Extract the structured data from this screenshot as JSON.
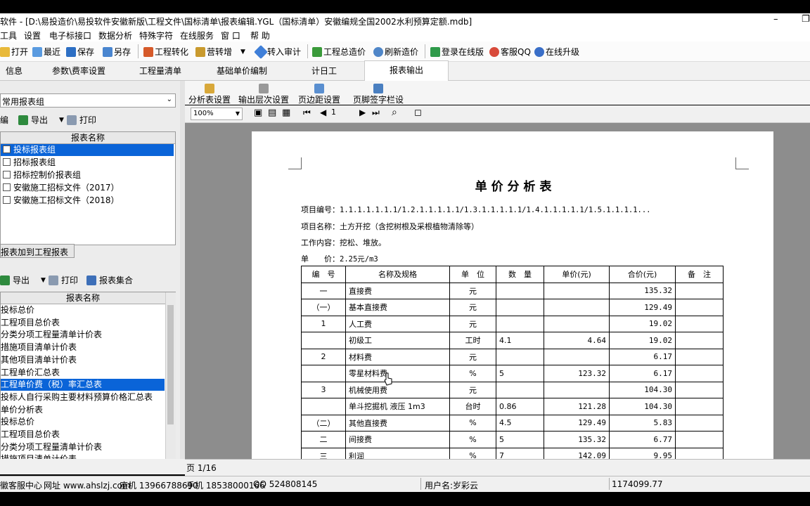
{
  "window": {
    "title": "软件 - [D:\\易投造价\\易投软件安徽新版\\工程文件\\国标清单\\报表编辑.YGL（国标清单）安徽编规全国2002水利预算定额.mdb]",
    "minimize": "–",
    "restore": "❐"
  },
  "menu": [
    "工具",
    "设置",
    "电子标接口",
    "数据分析",
    "特殊字符",
    "在线服务",
    "窗 口",
    "帮 助"
  ],
  "toolbar": {
    "open": "打开",
    "recent": "最近",
    "save": "保存",
    "save_as": "另存",
    "convert": "工程转化",
    "camp": "营转增",
    "import_audit": "转入审计",
    "total_price": "工程总造价",
    "refresh_price": "刷新造价",
    "login_online": "登录在线版",
    "service_qq": "客服QQ",
    "upgrade": "在线升级"
  },
  "tabs": [
    "信息",
    "参数\\费率设置",
    "工程量清单",
    "基础单价编制",
    "计日工",
    "报表输出"
  ],
  "left": {
    "group_select": "常用报表组",
    "top_actions": {
      "edit": "编",
      "export": "导出",
      "print": "打印"
    },
    "top_header": "报表名称",
    "groups": [
      {
        "label": "投标报表组",
        "selected": true
      },
      {
        "label": "招标报表组",
        "selected": false
      },
      {
        "label": "招标控制价报表组",
        "selected": false
      },
      {
        "label": "安徽施工招标文件（2017）",
        "selected": false
      },
      {
        "label": "安徽施工招标文件（2018）",
        "selected": false
      }
    ],
    "add_to_project": "报表加到工程报表",
    "bottom_actions": {
      "export": "导出",
      "print": "打印",
      "collection": "报表集合"
    },
    "bottom_header": "报表名称",
    "reports": [
      {
        "label": "投标总价",
        "selected": false
      },
      {
        "label": "工程项目总价表",
        "selected": false
      },
      {
        "label": "分类分项工程量清单计价表",
        "selected": false
      },
      {
        "label": "措施项目清单计价表",
        "selected": false
      },
      {
        "label": "其他项目清单计价表",
        "selected": false
      },
      {
        "label": "工程单价汇总表",
        "selected": false
      },
      {
        "label": "工程单价费（税）率汇总表",
        "selected": true
      },
      {
        "label": "投标人自行采购主要材料预算价格汇总表",
        "selected": false
      },
      {
        "label": "单价分析表",
        "selected": false
      },
      {
        "label": "投标总价",
        "selected": false
      },
      {
        "label": "工程项目总价表",
        "selected": false
      },
      {
        "label": "分类分项工程量清单计价表",
        "selected": false
      },
      {
        "label": "措施项目清单计价表",
        "selected": false
      }
    ]
  },
  "report_tools": {
    "analysis_settings": "分析表设置",
    "output_level": "输出层次设置",
    "margin_settings": "页边距设置",
    "header_footer": "页脚签字栏设置",
    "zoom": "100%",
    "page_input": "1"
  },
  "report": {
    "title": "单 价 分 析 表",
    "code_label": "项目编号：",
    "code_value": "1.1.1.1.1.1.1/1.2.1.1.1.1.1/1.3.1.1.1.1.1/1.4.1.1.1.1.1/1.5.1.1.1.1...",
    "name_label": "项目名称：",
    "name_value": "土方开挖（含挖树根及采根植物清除等）",
    "work_label": "工作内容：",
    "work_value": "挖松、堆放。",
    "price_label": "单　　价：",
    "price_value": "2.25元/m3",
    "columns": [
      "编　号",
      "名称及规格",
      "单　位",
      "数　量",
      "单价(元)",
      "合价(元)",
      "备　注"
    ],
    "rows": [
      [
        "一",
        "直接费",
        "元",
        "",
        "",
        "135.32",
        ""
      ],
      [
        "（一）",
        "基本直接费",
        "元",
        "",
        "",
        "129.49",
        ""
      ],
      [
        "1",
        "人工费",
        "元",
        "",
        "",
        "19.02",
        ""
      ],
      [
        "",
        "初级工",
        "工时",
        "4.1",
        "4.64",
        "19.02",
        ""
      ],
      [
        "2",
        "材料费",
        "元",
        "",
        "",
        "6.17",
        ""
      ],
      [
        "",
        "零星材料费",
        "%",
        "5",
        "123.32",
        "6.17",
        ""
      ],
      [
        "3",
        "机械使用费",
        "元",
        "",
        "",
        "104.30",
        ""
      ],
      [
        "",
        "单斗挖掘机 液压 1m3",
        "台时",
        "0.86",
        "121.28",
        "104.30",
        ""
      ],
      [
        "（二）",
        "其他直接费",
        "%",
        "4.5",
        "129.49",
        "5.83",
        ""
      ],
      [
        "二",
        "间接费",
        "%",
        "5",
        "135.32",
        "6.77",
        ""
      ],
      [
        "三",
        "利润",
        "%",
        "7",
        "142.09",
        "9.95",
        ""
      ]
    ]
  },
  "pagebar": {
    "page": "页 1/16"
  },
  "status": {
    "center": "徽客服中心",
    "site": "网址 www.ahslzj.com",
    "landline": "座机 13966788690",
    "mobile": "手机 18538000166",
    "qq": "QQ 524808145",
    "user": "用户名:岁彩云",
    "total": "1174099.77"
  }
}
